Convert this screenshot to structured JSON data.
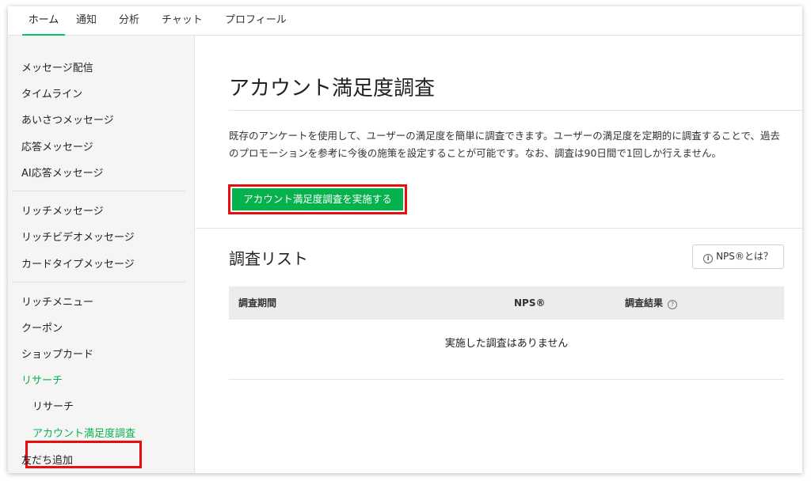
{
  "topnav": {
    "tabs": [
      "ホーム",
      "通知",
      "分析",
      "チャット",
      "プロフィール"
    ],
    "active_tab": "ホーム",
    "accent_color": "#06c755"
  },
  "sidebar": {
    "groups": [
      [
        "メッセージ配信",
        "タイムライン",
        "あいさつメッセージ",
        "応答メッセージ",
        "AI応答メッセージ"
      ],
      [
        "リッチメッセージ",
        "リッチビデオメッセージ",
        "カードタイプメッセージ"
      ],
      [
        "リッチメニュー",
        "クーポン",
        "ショップカード",
        "リサーチ"
      ]
    ],
    "research_sub": [
      "リサーチ",
      "アカウント満足度調査"
    ],
    "after": [
      "友だち追加"
    ],
    "active_item": "アカウント満足度調査"
  },
  "main": {
    "title": "アカウント満足度調査",
    "description": "既存のアンケートを使用して、ユーザーの満足度を簡単に調査できます。ユーザーの満足度を定期的に調査することで、過去のプロモーションを参考に今後の施策を設定することが可能です。なお、調査は90日間で1回しか行えません。",
    "cta_label": "アカウント満足度調査を実施する",
    "list_title": "調査リスト",
    "nps_button": "NPS®とは？",
    "table_headers": {
      "period": "調査期間",
      "nps": "NPS®",
      "result": "調査結果"
    },
    "empty_message": "実施した調査はありません"
  },
  "colors": {
    "brand_green": "#06b24c",
    "highlight_red": "#ea0d0d"
  }
}
